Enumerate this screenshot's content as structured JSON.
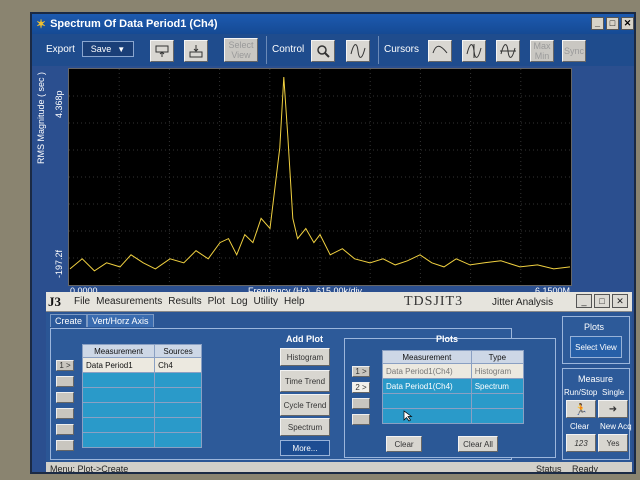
{
  "spectrum_window": {
    "title": "Spectrum Of Data Period1 (Ch4)",
    "controls": {
      "minimize": "_",
      "maximize": "□",
      "close": "✕"
    }
  },
  "toolbar": {
    "export_label": "Export",
    "save_label": "Save",
    "select_view_label": "Select View",
    "control_label": "Control",
    "cursors_label": "Cursors",
    "max_min_label": "Max Min",
    "sync_label": "Sync"
  },
  "plot": {
    "ylabel": "RMS Magnitude ( sec )",
    "ytop": "4.368p",
    "ybottom": "-197.2f",
    "xstart": "0.0000",
    "xend": "6.1500M",
    "xaxis_label": "Frequency (Hz)",
    "xdiv": "615.00k/div",
    "trace_color": "#f0d040"
  },
  "chart_data": {
    "type": "line",
    "title": "Spectrum Of Data Period1 (Ch4)",
    "xlabel": "Frequency (Hz)",
    "ylabel": "RMS Magnitude ( sec )",
    "xlim": [
      0,
      6150000
    ],
    "grid": true,
    "series": [
      {
        "name": "Data Period1 (Ch4)",
        "x": [
          0,
          150000,
          300000,
          450000,
          615000,
          750000,
          900000,
          1050000,
          1230000,
          1400000,
          1550000,
          1700000,
          1845000,
          1950000,
          2050000,
          2150000,
          2250000,
          2350000,
          2460000,
          2520000,
          2580000,
          2630000,
          2680000,
          2740000,
          2800000,
          2900000,
          3000000,
          3075000,
          3200000,
          3350000,
          3500000,
          3690000,
          3850000,
          4000000,
          4150000,
          4305000,
          4450000,
          4600000,
          4750000,
          4920000,
          5100000,
          5300000,
          5535000,
          5750000,
          5950000,
          6150000
        ],
        "values": [
          0.05,
          0.1,
          0.04,
          0.08,
          0.06,
          0.12,
          0.08,
          0.05,
          0.1,
          0.08,
          0.14,
          0.1,
          0.18,
          0.2,
          0.12,
          0.22,
          0.18,
          0.3,
          0.25,
          0.45,
          0.65,
          1.0,
          0.7,
          0.3,
          0.2,
          0.25,
          0.18,
          0.22,
          0.12,
          0.15,
          0.1,
          0.08,
          0.1,
          0.07,
          0.09,
          0.12,
          0.08,
          0.06,
          0.1,
          0.07,
          0.08,
          0.09,
          0.06,
          0.07,
          0.05,
          0.06
        ]
      }
    ]
  },
  "app": {
    "logo": "J3",
    "name": "TDSJIT3",
    "subtitle": "Jitter Analysis",
    "menu": [
      "File",
      "Measurements",
      "Results",
      "Plot",
      "Log",
      "Utility",
      "Help"
    ],
    "controls": {
      "minimize": "_",
      "maximize": "□",
      "close": "✕"
    }
  },
  "tabs": [
    "Create",
    "Vert/Horz Axis"
  ],
  "measure_table": {
    "headers": [
      "Measurement",
      "Sources"
    ],
    "rows": [
      [
        "Data Period1",
        "Ch4"
      ],
      [
        "",
        ""
      ],
      [
        "",
        ""
      ],
      [
        "",
        ""
      ],
      [
        "",
        ""
      ],
      [
        "",
        ""
      ]
    ],
    "row_buttons": [
      "1 >",
      ">",
      ">",
      ">",
      ">",
      ">"
    ]
  },
  "add_plot": {
    "title": "Add Plot",
    "buttons": [
      "Histogram",
      "Time Trend",
      "Cycle Trend",
      "Spectrum",
      "More..."
    ]
  },
  "plots": {
    "title": "Plots",
    "headers": [
      "Measurement",
      "Type"
    ],
    "rows": [
      [
        "Data Period1(Ch4)",
        "Histogram"
      ],
      [
        "Data Period1(Ch4)",
        "Spectrum"
      ],
      [
        "",
        ""
      ],
      [
        "",
        ""
      ]
    ],
    "row_buttons": [
      "1 >",
      "2 >",
      ">",
      ">"
    ],
    "clear": "Clear",
    "clear_all": "Clear All"
  },
  "right_panel": {
    "plots_title": "Plots",
    "select_view": "Select View",
    "measure_title": "Measure",
    "run_stop": "Run/Stop",
    "single": "Single",
    "clear": "Clear",
    "new_acq": "New Acq",
    "yes": "Yes",
    "clear_icon_text": "123"
  },
  "status": {
    "menu_path": "Menu: Plot->Create",
    "status_label": "Status",
    "status_value": "Ready"
  }
}
